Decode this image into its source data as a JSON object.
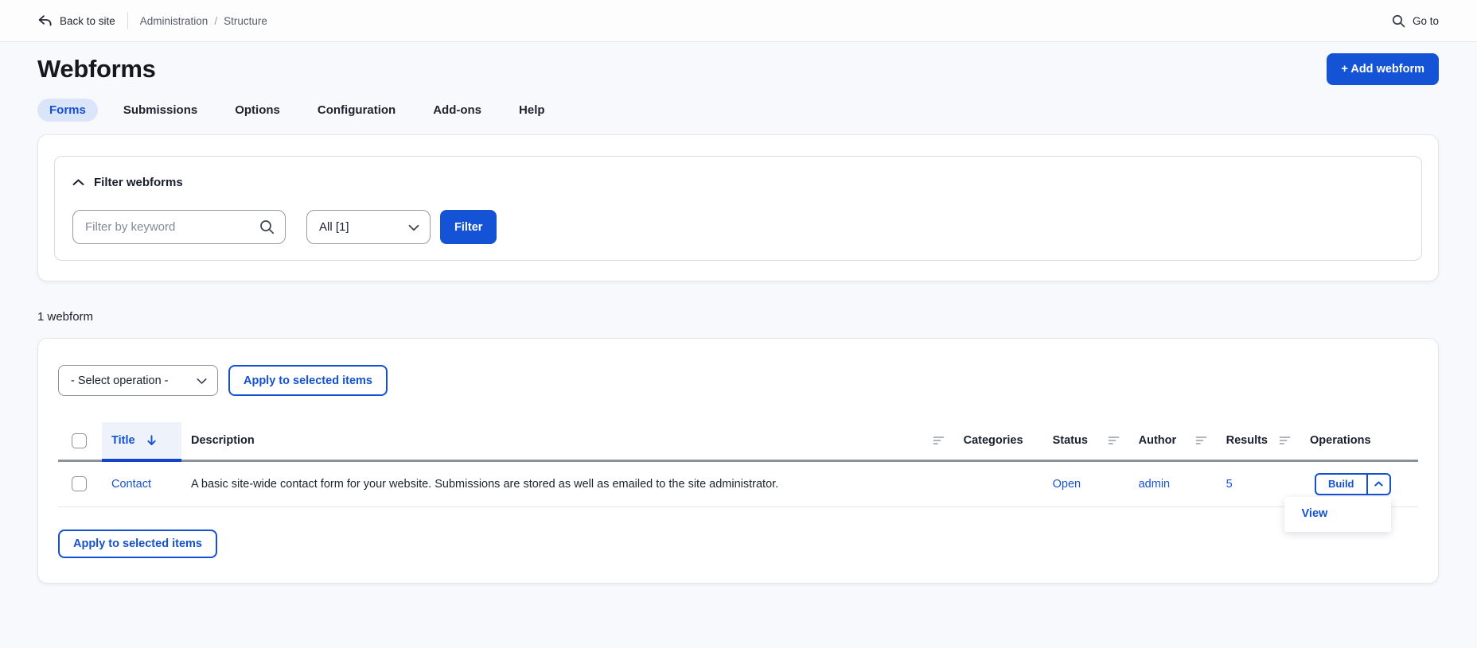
{
  "topbar": {
    "back_label": "Back to site",
    "breadcrumb": [
      "Administration",
      "Structure"
    ],
    "breadcrumb_separator": "/",
    "goto_label": "Go to"
  },
  "header": {
    "title": "Webforms",
    "add_button": "+ Add webform"
  },
  "tabs": [
    {
      "label": "Forms",
      "active": true
    },
    {
      "label": "Submissions",
      "active": false
    },
    {
      "label": "Options",
      "active": false
    },
    {
      "label": "Configuration",
      "active": false
    },
    {
      "label": "Add-ons",
      "active": false
    },
    {
      "label": "Help",
      "active": false
    }
  ],
  "filter": {
    "legend": "Filter webforms",
    "keyword_placeholder": "Filter by keyword",
    "keyword_value": "",
    "category_value": "All [1]",
    "submit_label": "Filter"
  },
  "count_text": "1 webform",
  "bulk": {
    "select_value": "- Select operation -",
    "apply_label": "Apply to selected items"
  },
  "table": {
    "headers": {
      "title": "Title",
      "description": "Description",
      "categories": "Categories",
      "status": "Status",
      "author": "Author",
      "results": "Results",
      "operations": "Operations"
    },
    "sort": {
      "column": "Title",
      "direction": "descending"
    },
    "rows": [
      {
        "title": "Contact",
        "description": "A basic site-wide contact form for your website. Submissions are stored as well as emailed to the site administrator.",
        "categories": "",
        "status": "Open",
        "author": "admin",
        "results": "5",
        "primary_op": "Build",
        "menu_open": true,
        "menu_items": [
          "View"
        ]
      }
    ]
  },
  "footer_apply_label": "Apply to selected items",
  "colors": {
    "primary_blue": "#1553d6",
    "link_blue": "#1552d4",
    "active_tab_bg": "#dbe5f9",
    "title_sort_underline": "#1245cb",
    "page_background": "#f8f9fc"
  }
}
